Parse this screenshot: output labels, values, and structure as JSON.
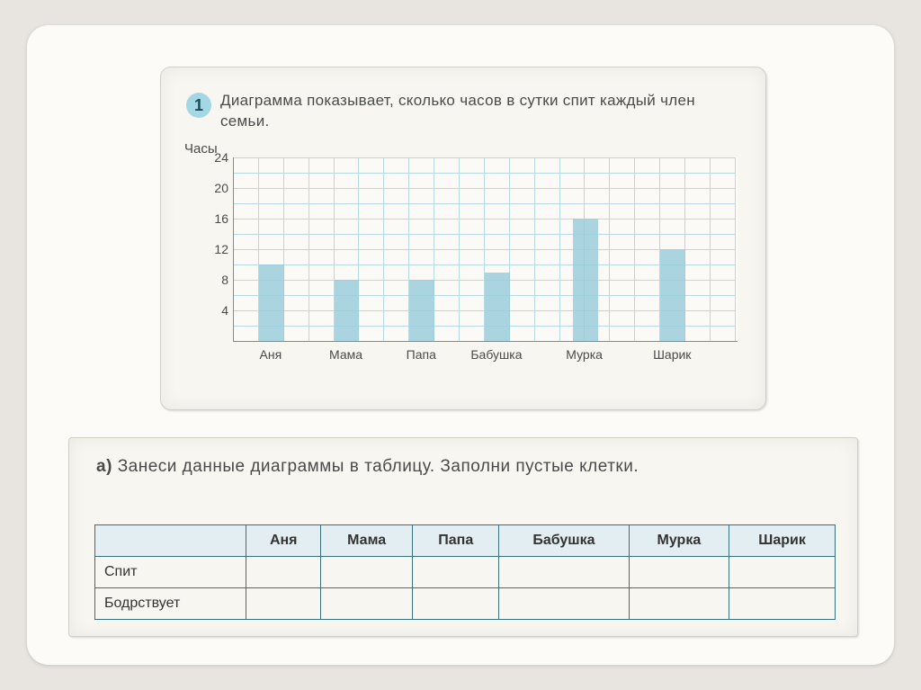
{
  "badge_number": "1",
  "question": "Диаграмма показывает, сколько часов в сутки спит каждый член семьи.",
  "yaxis_title": "Часы",
  "task_a_marker": "а)",
  "task_a_text": "Занеси данные диаграммы в таблицу. Заполни пустые клетки.",
  "table_rows": [
    "Спит",
    "Бодрствует"
  ],
  "chart_data": {
    "type": "bar",
    "title": "",
    "xlabel": "",
    "ylabel": "Часы",
    "ylim": [
      0,
      24
    ],
    "yticks": [
      4,
      8,
      12,
      16,
      20,
      24
    ],
    "categories": [
      "Аня",
      "Мама",
      "Папа",
      "Бабушка",
      "Мурка",
      "Шарик"
    ],
    "values": [
      10,
      8,
      8,
      9,
      16,
      12
    ],
    "grid": true,
    "legend": false
  }
}
